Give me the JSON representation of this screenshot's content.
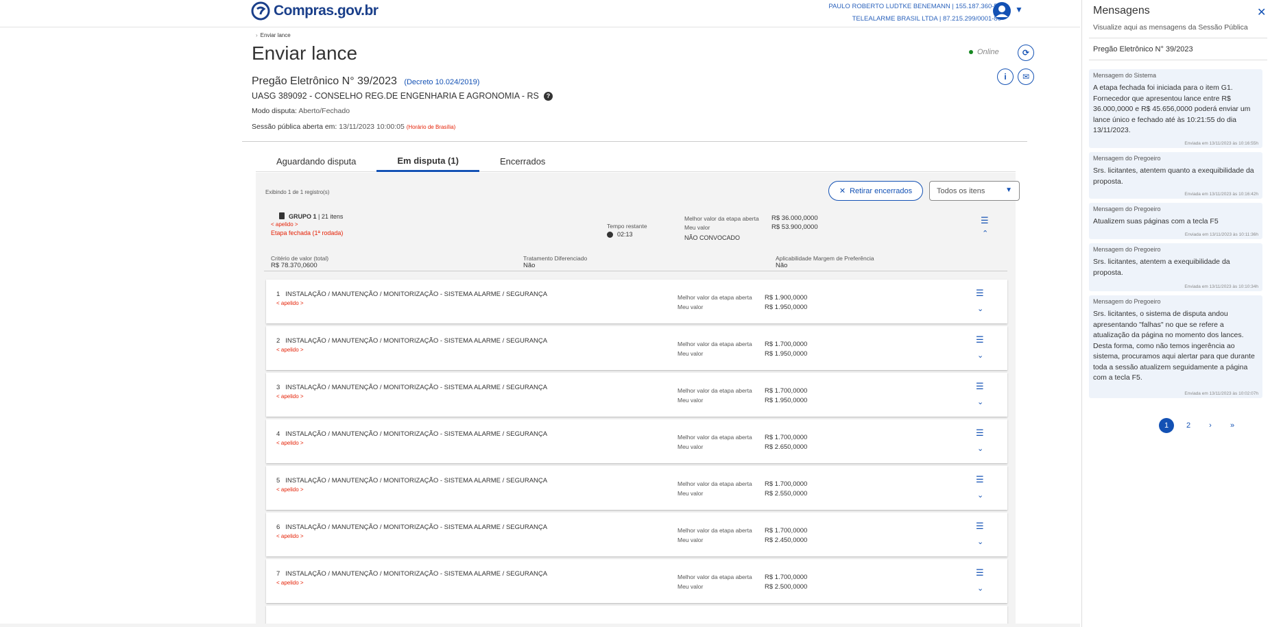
{
  "header": {
    "logo_text": "Compras.gov.br",
    "user_line1": "PAULO ROBERTO LUDTKE BENEMANN | 155.187.360-53",
    "user_line2": "TELEALARME BRASIL LTDA | 87.215.299/0001-80"
  },
  "page": {
    "breadcrumb": "Enviar lance",
    "title": "Enviar lance",
    "status": "Online",
    "pregao_title": "Pregão Eletrônico N° 39/2023",
    "decreto": "(Decreto 10.024/2019)",
    "uasg": "UASG 389092 - CONSELHO REG.DE ENGENHARIA E AGRONOMIA - RS",
    "modo_label": "Modo disputa:",
    "modo_value": "Aberto/Fechado",
    "sessao_label": "Sessão pública aberta em:",
    "sessao_value": "13/11/2023 10:00:05",
    "sessao_note": "(Horário de Brasília)"
  },
  "tabs": [
    {
      "label": "Aguardando disputa"
    },
    {
      "label": "Em disputa (1)"
    },
    {
      "label": "Encerrados"
    }
  ],
  "panel": {
    "showing": "Exibindo 1 de 1 registro(s)",
    "retirar_label": "Retirar encerrados",
    "filter_value": "Todos os itens"
  },
  "group": {
    "title": "GRUPO 1",
    "count": "| 21 itens",
    "apelido": "< apelido >",
    "etapa": "Etapa fechada (1ª rodada)",
    "tempo_label": "Tempo restante",
    "tempo_value": "02:13",
    "melhor_label": "Melhor valor da etapa aberta",
    "melhor_value": "R$ 36.000,0000",
    "meu_label": "Meu valor",
    "meu_value": "R$ 53.900,0000",
    "status": "NÃO CONVOCADO",
    "criterio_label": "Critério de valor (total)",
    "criterio_value": "R$ 78.370,0600",
    "tratamento_label": "Tratamento Diferenciado",
    "tratamento_value": "Não",
    "aplicabilidade_label": "Aplicabilidade Margem de Preferência",
    "aplicabilidade_value": "Não"
  },
  "item_labels": {
    "melhor": "Melhor valor da etapa aberta",
    "meu": "Meu valor",
    "apelido": "< apelido >"
  },
  "items": [
    {
      "num": "1",
      "desc": "INSTALAÇÃO / MANUTENÇÃO / MONITORIZAÇÃO - SISTEMA ALARME / SEGURANÇA",
      "melhor": "R$ 1.900,0000",
      "meu": "R$ 1.950,0000"
    },
    {
      "num": "2",
      "desc": "INSTALAÇÃO / MANUTENÇÃO / MONITORIZAÇÃO - SISTEMA ALARME / SEGURANÇA",
      "melhor": "R$ 1.700,0000",
      "meu": "R$ 1.950,0000"
    },
    {
      "num": "3",
      "desc": "INSTALAÇÃO / MANUTENÇÃO / MONITORIZAÇÃO - SISTEMA ALARME / SEGURANÇA",
      "melhor": "R$ 1.700,0000",
      "meu": "R$ 1.950,0000"
    },
    {
      "num": "4",
      "desc": "INSTALAÇÃO / MANUTENÇÃO / MONITORIZAÇÃO - SISTEMA ALARME / SEGURANÇA",
      "melhor": "R$ 1.700,0000",
      "meu": "R$ 2.650,0000"
    },
    {
      "num": "5",
      "desc": "INSTALAÇÃO / MANUTENÇÃO / MONITORIZAÇÃO - SISTEMA ALARME / SEGURANÇA",
      "melhor": "R$ 1.700,0000",
      "meu": "R$ 2.550,0000"
    },
    {
      "num": "6",
      "desc": "INSTALAÇÃO / MANUTENÇÃO / MONITORIZAÇÃO - SISTEMA ALARME / SEGURANÇA",
      "melhor": "R$ 1.700,0000",
      "meu": "R$ 2.450,0000"
    },
    {
      "num": "7",
      "desc": "INSTALAÇÃO / MANUTENÇÃO / MONITORIZAÇÃO - SISTEMA ALARME / SEGURANÇA",
      "melhor": "R$ 1.700,0000",
      "meu": "R$ 2.500,0000"
    }
  ],
  "side": {
    "title": "Mensagens",
    "subtitle": "Visualize aqui as mensagens da Sessão Pública",
    "pregao": "Pregão Eletrônico N° 39/2023",
    "messages": [
      {
        "head": "Mensagem do Sistema",
        "body": "A etapa fechada foi iniciada para o item G1. Fornecedor que apresentou lance entre R$ 36.000,0000 e R$ 45.656,0000 poderá enviar um lance único e fechado até às 10:21:55 do dia 13/11/2023.",
        "time": "Enviada em 13/11/2023 às 10:16:55h"
      },
      {
        "head": "Mensagem do Pregoeiro",
        "body": "Srs. licitantes, atentem quanto a exequibilidade da proposta.",
        "time": "Enviada em 13/11/2023 às 10:16:42h"
      },
      {
        "head": "Mensagem do Pregoeiro",
        "body": "Atualizem suas páginas com a tecla F5",
        "time": "Enviada em 13/11/2023 às 10:11:36h"
      },
      {
        "head": "Mensagem do Pregoeiro",
        "body": "Srs. licitantes, atentem a exequibilidade da proposta.",
        "time": "Enviada em 13/11/2023 às 10:10:34h"
      },
      {
        "head": "Mensagem do Pregoeiro",
        "body": "Srs. licitantes, o sistema de disputa andou apresentando \"falhas\" no que se refere a atualização da página no momento dos lances. Desta forma, como não temos ingerência ao sistema, procuramos aqui alertar para que durante toda a sessão atualizem seguidamente a página com a tecla F5.",
        "time": "Enviada em 13/11/2023 às 10:02:07h"
      }
    ],
    "pages": [
      "1",
      "2"
    ]
  },
  "icons": {
    "next": "›",
    "last": "»",
    "close": "✕",
    "list": "☰",
    "chevron": "⌄"
  },
  "colors": {
    "primary": "#1351b4",
    "danger": "#e52207",
    "online": "#168821"
  }
}
